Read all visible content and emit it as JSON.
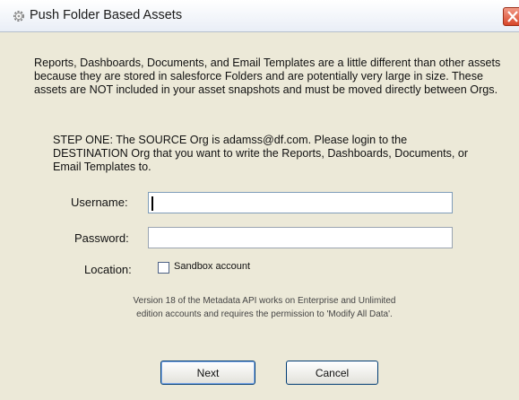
{
  "window": {
    "title": "Push Folder Based Assets",
    "icon": "gear-icon",
    "close_icon": "close-icon"
  },
  "intro_text": "Reports, Dashboards, Documents, and Email Templates are a little different than other assets because they are stored in salesforce Folders and are potentially very large in size. These assets are NOT included in your asset snapshots and must be moved directly between Orgs.",
  "step_text": "STEP ONE: The SOURCE Org is adamss@df.com. Please login to the DESTINATION Org that you want to write the Reports, Dashboards, Documents, or Email Templates to.",
  "form": {
    "username_label": "Username:",
    "username_value": "",
    "password_label": "Password:",
    "password_value": "",
    "location_label": "Location:",
    "sandbox_label": "Sandbox account",
    "sandbox_checked": false
  },
  "note": "Version 18 of the Metadata API works on Enterprise and Unlimited edition accounts and requires the permission to 'Modify All Data'.",
  "buttons": {
    "next": "Next",
    "cancel": "Cancel"
  },
  "colors": {
    "dialog_background": "#ece9d8",
    "close_button": "#d8462a",
    "button_border": "#003c74"
  }
}
